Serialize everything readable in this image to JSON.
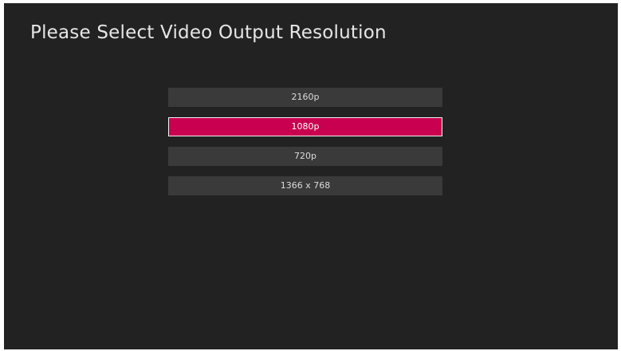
{
  "title": "Please Select Video Output Resolution",
  "options": [
    {
      "label": "2160p",
      "selected": false
    },
    {
      "label": "1080p",
      "selected": true
    },
    {
      "label": "720p",
      "selected": false
    },
    {
      "label": "1366 x 768",
      "selected": false
    }
  ],
  "colors": {
    "background": "#222222",
    "option_bg": "#3a3a3a",
    "selected_bg": "#c9004f",
    "selected_border": "#f2f2f2",
    "title_text": "#e6e6e6"
  }
}
